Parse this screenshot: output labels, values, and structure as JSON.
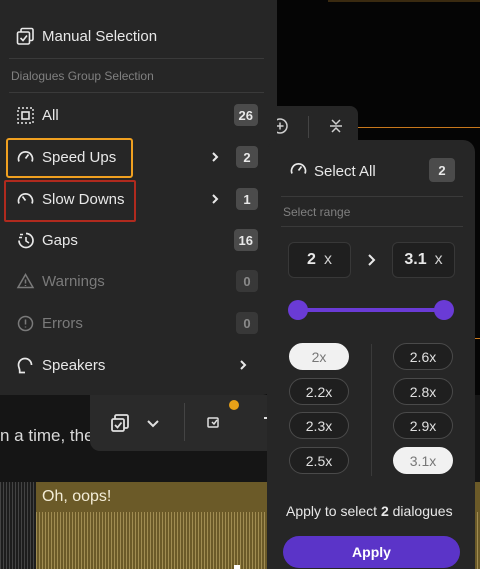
{
  "background": {
    "transcript_text": "n a time, the",
    "waveform_label": "Oh, oops!"
  },
  "menu": {
    "manual_selection": "Manual Selection",
    "group_title": "Dialogues Group Selection",
    "items": [
      {
        "label": "All",
        "count": "26",
        "icon": "select-all-icon"
      },
      {
        "label": "Speed Ups",
        "count": "2",
        "icon": "speedometer-icon"
      },
      {
        "label": "Slow Downs",
        "count": "1",
        "icon": "speedometer-slow-icon"
      },
      {
        "label": "Gaps",
        "count": "16",
        "icon": "gap-clock-icon"
      },
      {
        "label": "Warnings",
        "count": "0",
        "icon": "warning-icon"
      },
      {
        "label": "Errors",
        "count": "0",
        "icon": "error-icon"
      },
      {
        "label": "Speakers",
        "icon": "speaker-icon"
      }
    ]
  },
  "submenu": {
    "select_all": "Select All",
    "select_all_count": "2",
    "range_label": "Select range",
    "range_min": "2",
    "range_max": "3.1",
    "unit": "x",
    "chips_left": [
      "2x",
      "2.2x",
      "2.3x",
      "2.5x"
    ],
    "chips_right": [
      "2.6x",
      "2.8x",
      "2.9x",
      "3.1x"
    ],
    "apply_prefix": "Apply to select",
    "apply_count": "2",
    "apply_suffix": "dialogues",
    "apply_button": "Apply"
  },
  "colors": {
    "accent": "#5b34c8",
    "highlight_orange": "#f0a020",
    "highlight_red": "#b02a1e",
    "notification_dot": "#e8a118"
  }
}
